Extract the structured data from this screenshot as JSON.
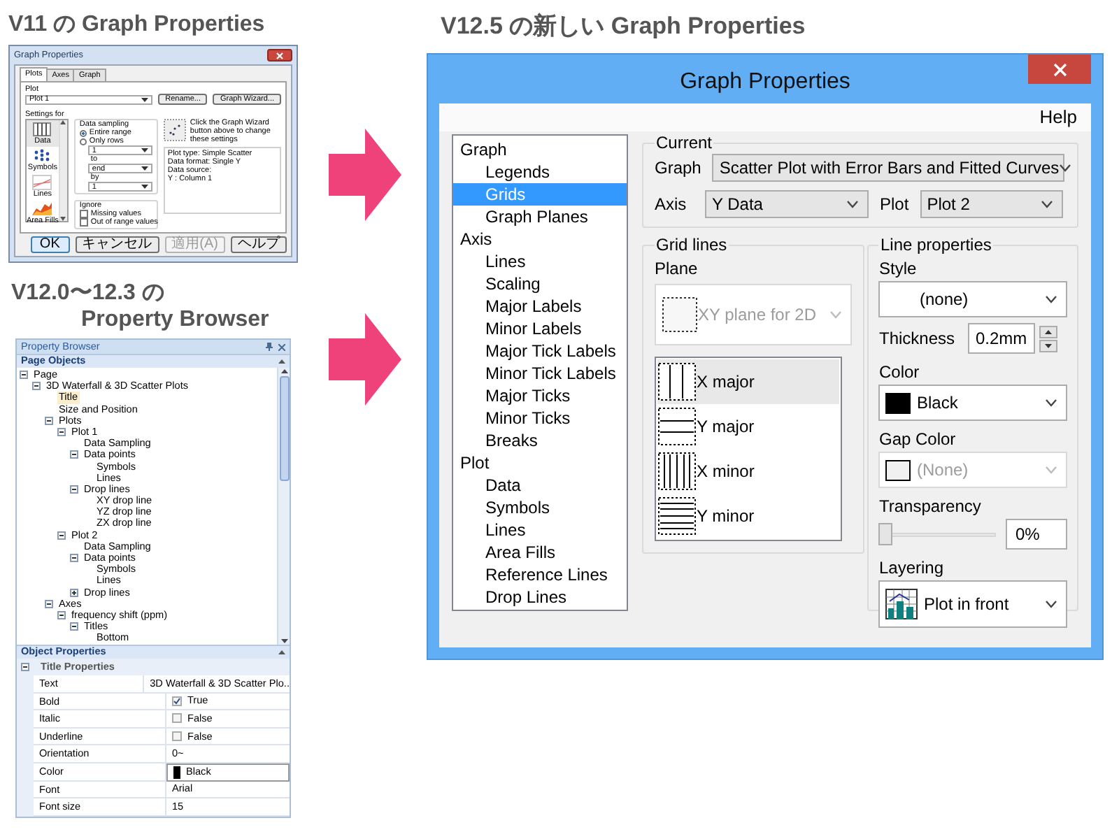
{
  "v11": {
    "heading": "V11 の Graph Properties",
    "dialog": {
      "title": "Graph Properties",
      "tabs": [
        {
          "label": "Plots",
          "selected": true
        },
        {
          "label": "Axes",
          "selected": false
        },
        {
          "label": "Graph",
          "selected": false
        }
      ],
      "plot_label": "Plot",
      "plot_value": "Plot 1",
      "rename_button": "Rename...",
      "wizard_button": "Graph Wizard...",
      "settings_label": "Settings for",
      "settings_items": [
        {
          "label": "Data",
          "kind": "data",
          "selected": true
        },
        {
          "label": "Symbols",
          "kind": "symbols",
          "selected": false
        },
        {
          "label": "Lines",
          "kind": "lines",
          "selected": false
        },
        {
          "label": "Area Fills",
          "kind": "fills",
          "selected": false
        }
      ],
      "data_sampling": {
        "title": "Data sampling",
        "options": [
          {
            "label": "Entire range",
            "selected": true
          },
          {
            "label": "Only rows",
            "selected": false
          }
        ],
        "from": "1",
        "to_label": "to",
        "to": "end",
        "by_label": "by",
        "by": "1"
      },
      "wizard_hint": "Click the Graph Wizard button above to change these settings",
      "info_lines": [
        "Plot type: Simple Scatter",
        "Data format: Single Y",
        "Data source:",
        "Y : Column 1"
      ],
      "ignore": {
        "title": "Ignore",
        "options": [
          {
            "label": "Missing values",
            "checked": false
          },
          {
            "label": "Out of range values",
            "checked": false
          }
        ]
      },
      "buttons": [
        {
          "label": "OK",
          "disabled": false
        },
        {
          "label": "キャンセル",
          "disabled": false
        },
        {
          "label": "適用(A)",
          "disabled": true
        },
        {
          "label": "ヘルプ",
          "disabled": false
        }
      ]
    }
  },
  "v12": {
    "heading": [
      "V12.0〜12.3 の",
      "Property Browser"
    ],
    "browser": {
      "title": "Property Browser",
      "page_objects": "Page Objects",
      "tree": [
        {
          "label": "Page",
          "expanded": true,
          "selected": false,
          "children": [
            {
              "label": "3D Waterfall & 3D Scatter Plots",
              "expanded": true,
              "selected": false,
              "children": [
                {
                  "label": "Title",
                  "selected": true
                },
                {
                  "label": "Size and Position",
                  "selected": false
                },
                {
                  "label": "Plots",
                  "expanded": true,
                  "selected": false,
                  "children": [
                    {
                      "label": "Plot 1",
                      "expanded": true,
                      "selected": false,
                      "children": [
                        {
                          "label": "Data Sampling",
                          "selected": false
                        },
                        {
                          "label": "Data points",
                          "expanded": true,
                          "selected": false,
                          "children": [
                            {
                              "label": "Symbols",
                              "selected": false
                            },
                            {
                              "label": "Lines",
                              "selected": false
                            }
                          ]
                        },
                        {
                          "label": "Drop lines",
                          "expanded": true,
                          "selected": false,
                          "children": [
                            {
                              "label": "XY drop line",
                              "selected": false
                            },
                            {
                              "label": "YZ drop line",
                              "selected": false
                            },
                            {
                              "label": "ZX drop line",
                              "selected": false
                            }
                          ]
                        }
                      ]
                    },
                    {
                      "label": "Plot 2",
                      "expanded": true,
                      "selected": false,
                      "children": [
                        {
                          "label": "Data Sampling",
                          "selected": false
                        },
                        {
                          "label": "Data points",
                          "expanded": true,
                          "selected": false,
                          "children": [
                            {
                              "label": "Symbols",
                              "selected": false
                            },
                            {
                              "label": "Lines",
                              "selected": false
                            }
                          ]
                        },
                        {
                          "label": "Drop lines",
                          "expanded": false,
                          "selected": false
                        }
                      ]
                    }
                  ]
                },
                {
                  "label": "Axes",
                  "expanded": true,
                  "selected": false,
                  "children": [
                    {
                      "label": "frequency shift (ppm)",
                      "expanded": true,
                      "selected": false,
                      "children": [
                        {
                          "label": "Titles",
                          "expanded": true,
                          "selected": false,
                          "children": [
                            {
                              "label": "Bottom",
                              "selected": false
                            }
                          ]
                        }
                      ]
                    }
                  ]
                }
              ]
            }
          ]
        }
      ],
      "object_properties": "Object Properties",
      "group": "Title Properties",
      "group_expanded": true,
      "rows": [
        {
          "name": "Text",
          "kind": "text",
          "value": "3D Waterfall & 3D Scatter Plo.."
        },
        {
          "name": "Bold",
          "kind": "check",
          "checked": true,
          "value": "True"
        },
        {
          "name": "Italic",
          "kind": "check",
          "checked": false,
          "value": "False"
        },
        {
          "name": "Underline",
          "kind": "check",
          "checked": false,
          "value": "False"
        },
        {
          "name": "Orientation",
          "kind": "text",
          "value": "0~"
        },
        {
          "name": "Color",
          "kind": "color",
          "color": "#000000",
          "value": "Black"
        },
        {
          "name": "Font",
          "kind": "text",
          "value": "Arial"
        },
        {
          "name": "Font size",
          "kind": "text",
          "value": "15"
        }
      ]
    }
  },
  "v125": {
    "heading": "V12.5 の新しい Graph Properties",
    "dialog": {
      "title": "Graph Properties",
      "menu": [
        "Help"
      ],
      "nav": [
        {
          "label": "Graph",
          "selected": false,
          "children": [
            {
              "label": "Legends",
              "selected": false
            },
            {
              "label": "Grids",
              "selected": true
            },
            {
              "label": "Graph Planes",
              "selected": false
            }
          ]
        },
        {
          "label": "Axis",
          "selected": false,
          "children": [
            {
              "label": "Lines",
              "selected": false
            },
            {
              "label": "Scaling",
              "selected": false
            },
            {
              "label": "Major Labels",
              "selected": false
            },
            {
              "label": "Minor Labels",
              "selected": false
            },
            {
              "label": "Major Tick Labels",
              "selected": false
            },
            {
              "label": "Minor Tick Labels",
              "selected": false
            },
            {
              "label": "Major Ticks",
              "selected": false
            },
            {
              "label": "Minor Ticks",
              "selected": false
            },
            {
              "label": "Breaks",
              "selected": false
            }
          ]
        },
        {
          "label": "Plot",
          "selected": false,
          "children": [
            {
              "label": "Data",
              "selected": false
            },
            {
              "label": "Symbols",
              "selected": false
            },
            {
              "label": "Lines",
              "selected": false
            },
            {
              "label": "Area Fills",
              "selected": false
            },
            {
              "label": "Reference Lines",
              "selected": false
            },
            {
              "label": "Drop Lines",
              "selected": false
            }
          ]
        }
      ],
      "current": {
        "title": "Current",
        "graph_label": "Graph",
        "graph": "Scatter Plot with Error Bars and Fitted Curves",
        "axis_label": "Axis",
        "axis": "Y Data",
        "plot_label": "Plot",
        "plot": "Plot 2"
      },
      "grid_lines": {
        "title": "Grid lines",
        "plane_label": "Plane",
        "plane": {
          "value": "XY plane for 2D",
          "disabled": true
        },
        "items": [
          {
            "label": "X major",
            "kind": "x-major",
            "selected": true
          },
          {
            "label": "Y major",
            "kind": "y-major",
            "selected": false
          },
          {
            "label": "X minor",
            "kind": "x-minor",
            "selected": false
          },
          {
            "label": "Y minor",
            "kind": "y-minor",
            "selected": false
          }
        ]
      },
      "line_properties": {
        "title": "Line properties",
        "style_label": "Style",
        "style": "(none)",
        "thickness_label": "Thickness",
        "thickness": "0.2mm",
        "color_label": "Color",
        "color_choice": "Black",
        "gap_color_label": "Gap Color",
        "gap_color": {
          "value": "(None)",
          "disabled": true
        },
        "transparency_label": "Transparency",
        "transparency": {
          "level": 0,
          "reading": "0%"
        },
        "layering_label": "Layering",
        "layering": "Plot in front"
      }
    }
  }
}
